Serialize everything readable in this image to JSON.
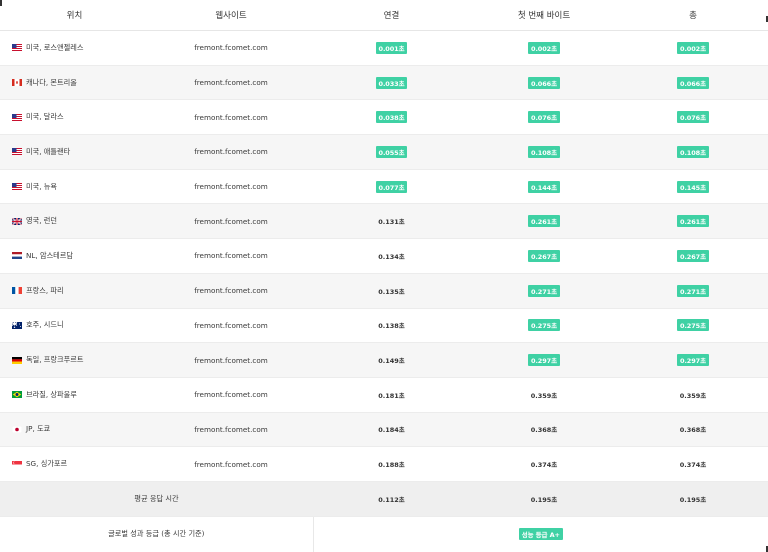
{
  "header": {
    "location": "위치",
    "website": "웹사이트",
    "connect": "연결",
    "ttfb": "첫 번째 바이트",
    "total": "총"
  },
  "rows": [
    {
      "flag": "us",
      "location": "미국, 로스앤젤레스",
      "site": "fremont.fcomet.com",
      "connect": "0.001초",
      "ttfb": "0.002초",
      "total": "0.002초",
      "c_hl": true,
      "t_hl": true,
      "tt_hl": true
    },
    {
      "flag": "ca",
      "location": "캐나다, 몬트리올",
      "site": "fremont.fcomet.com",
      "connect": "0.033초",
      "ttfb": "0.066초",
      "total": "0.066초",
      "c_hl": true,
      "t_hl": true,
      "tt_hl": true
    },
    {
      "flag": "us",
      "location": "미국, 달라스",
      "site": "fremont.fcomet.com",
      "connect": "0.038초",
      "ttfb": "0.076초",
      "total": "0.076초",
      "c_hl": true,
      "t_hl": true,
      "tt_hl": true
    },
    {
      "flag": "us",
      "location": "미국, 애틀랜타",
      "site": "fremont.fcomet.com",
      "connect": "0.055초",
      "ttfb": "0.108초",
      "total": "0.108초",
      "c_hl": true,
      "t_hl": true,
      "tt_hl": true
    },
    {
      "flag": "us",
      "location": "미국, 뉴욕",
      "site": "fremont.fcomet.com",
      "connect": "0.077초",
      "ttfb": "0.144초",
      "total": "0.145초",
      "c_hl": true,
      "t_hl": true,
      "tt_hl": true
    },
    {
      "flag": "gb",
      "location": "영국, 런던",
      "site": "fremont.fcomet.com",
      "connect": "0.131초",
      "ttfb": "0.261초",
      "total": "0.261초",
      "c_hl": false,
      "t_hl": true,
      "tt_hl": true
    },
    {
      "flag": "nl",
      "location": "NL, 암스테르담",
      "site": "fremont.fcomet.com",
      "connect": "0.134초",
      "ttfb": "0.267초",
      "total": "0.267초",
      "c_hl": false,
      "t_hl": true,
      "tt_hl": true
    },
    {
      "flag": "fr",
      "location": "프랑스, 파리",
      "site": "fremont.fcomet.com",
      "connect": "0.135초",
      "ttfb": "0.271초",
      "total": "0.271초",
      "c_hl": false,
      "t_hl": true,
      "tt_hl": true
    },
    {
      "flag": "au",
      "location": "호주, 시드니",
      "site": "fremont.fcomet.com",
      "connect": "0.138초",
      "ttfb": "0.275초",
      "total": "0.275초",
      "c_hl": false,
      "t_hl": true,
      "tt_hl": true
    },
    {
      "flag": "de",
      "location": "독일, 프랑크푸르트",
      "site": "fremont.fcomet.com",
      "connect": "0.149초",
      "ttfb": "0.297초",
      "total": "0.297초",
      "c_hl": false,
      "t_hl": true,
      "tt_hl": true
    },
    {
      "flag": "br",
      "location": "브라질, 상파울루",
      "site": "fremont.fcomet.com",
      "connect": "0.181초",
      "ttfb": "0.359초",
      "total": "0.359초",
      "c_hl": false,
      "t_hl": false,
      "tt_hl": false
    },
    {
      "flag": "jp",
      "location": "JP, 도쿄",
      "site": "fremont.fcomet.com",
      "connect": "0.184초",
      "ttfb": "0.368초",
      "total": "0.368초",
      "c_hl": false,
      "t_hl": false,
      "tt_hl": false
    },
    {
      "flag": "sg",
      "location": "SG, 싱가포르",
      "site": "fremont.fcomet.com",
      "connect": "0.188초",
      "ttfb": "0.374초",
      "total": "0.374초",
      "c_hl": false,
      "t_hl": false,
      "tt_hl": false
    }
  ],
  "average": {
    "label": "평균 응답 시간",
    "connect": "0.112초",
    "ttfb": "0.195초",
    "total": "0.195초"
  },
  "grade": {
    "label": "글로벌 성과 등급 (총 시간 기준)",
    "badge": "성능 등급 A+"
  },
  "colors": {
    "badge": "#3fd1a4",
    "alt_row": "#f6f6f6",
    "avg_row": "#efefef"
  }
}
